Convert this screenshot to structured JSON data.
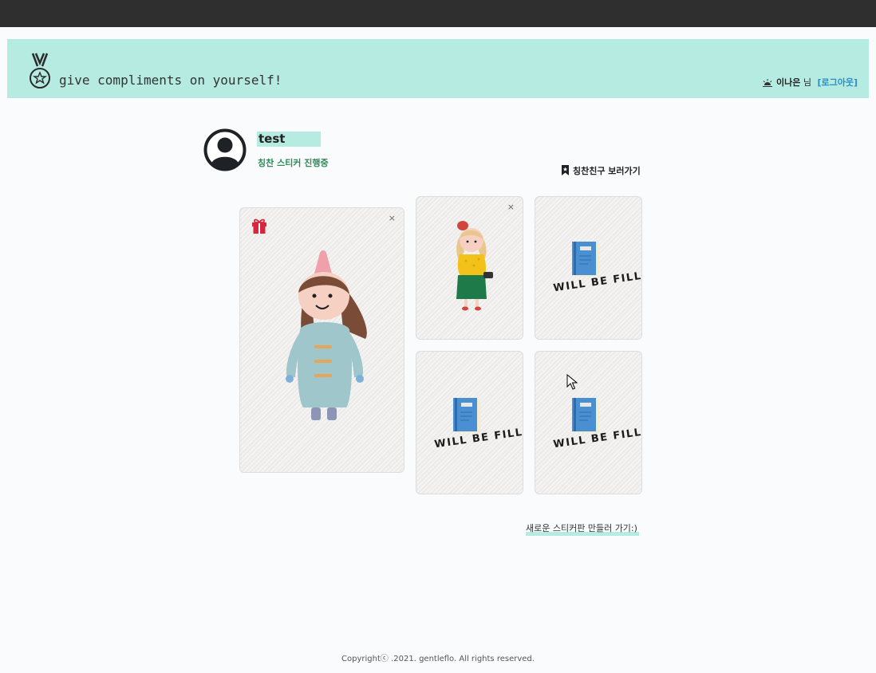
{
  "header": {
    "title": "give compliments on yourself!",
    "user_name": "이나은",
    "user_suffix": "님",
    "logout_label": "[로그아웃]"
  },
  "profile": {
    "name": "test",
    "status": "칭찬 스티커 진행중",
    "friends_link": "칭찬친구 보러가기"
  },
  "cards": {
    "close_symbol": "×",
    "placeholder_text": "WILL BE FILLED"
  },
  "actions": {
    "new_board": "새로운 스티커판 만들러 가기:)"
  },
  "footer": {
    "copyright": "Copyrightⓒ .2021. gentleflo. All rights reserved."
  },
  "colors": {
    "header_bg": "#b5ebe0",
    "topbar": "#2f2f2f",
    "status_green": "#2e8b57",
    "logout_blue": "#2a8ec7"
  }
}
